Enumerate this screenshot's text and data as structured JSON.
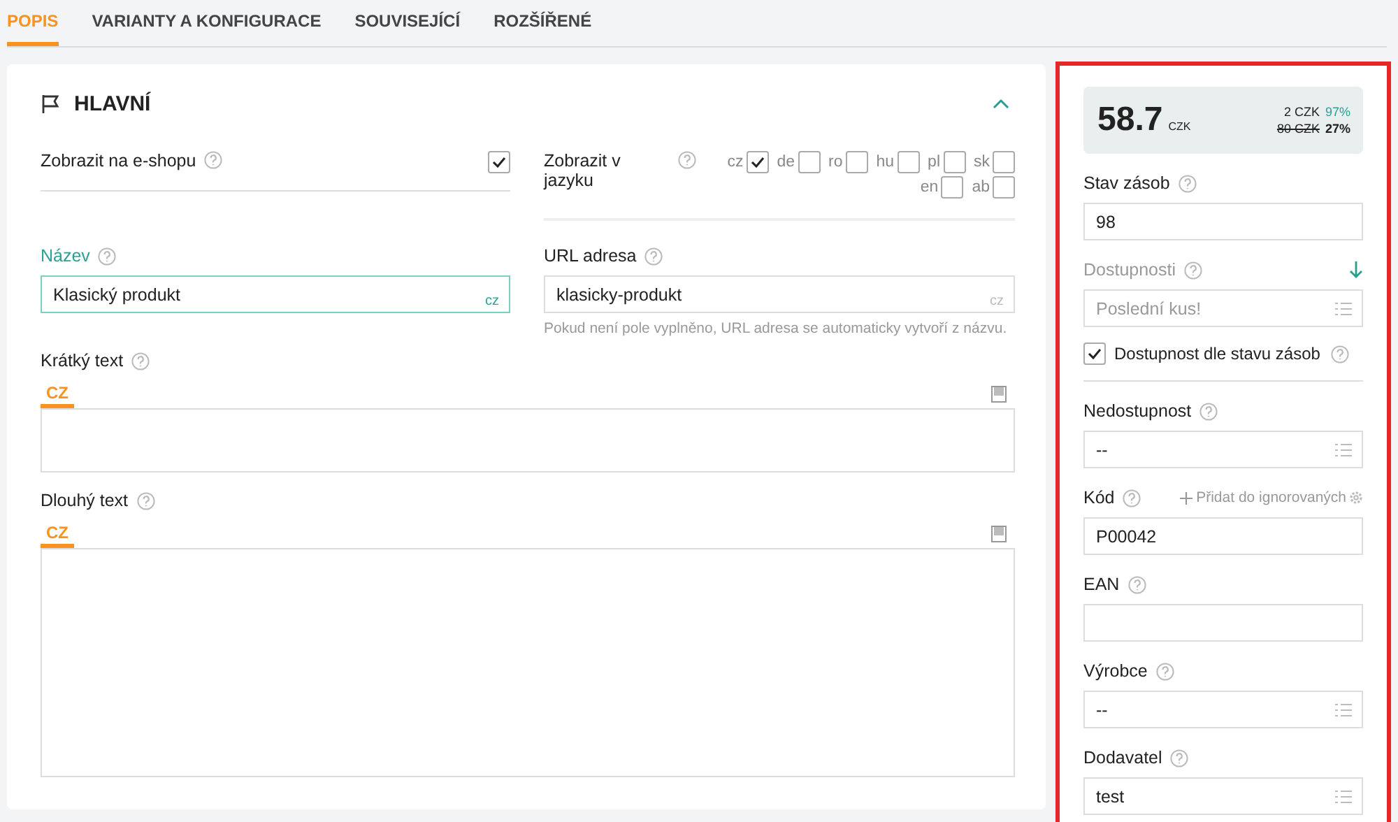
{
  "tabs": [
    {
      "label": "POPIS",
      "selected": true
    },
    {
      "label": "VARIANTY A KONFIGURACE",
      "selected": false
    },
    {
      "label": "SOUVISEJÍCÍ",
      "selected": false
    },
    {
      "label": "ROZŠÍŘENÉ",
      "selected": false
    }
  ],
  "section": {
    "title": "HLAVNÍ",
    "expanded": true
  },
  "show_on_eshop": {
    "label": "Zobrazit na e-shopu",
    "checked": true
  },
  "languages": {
    "label": "Zobrazit v jazyku",
    "items": [
      {
        "code": "cz",
        "checked": true
      },
      {
        "code": "de",
        "checked": false
      },
      {
        "code": "ro",
        "checked": false
      },
      {
        "code": "hu",
        "checked": false
      },
      {
        "code": "pl",
        "checked": false
      },
      {
        "code": "sk",
        "checked": false
      },
      {
        "code": "en",
        "checked": false
      },
      {
        "code": "ab",
        "checked": false
      }
    ]
  },
  "name_field": {
    "label": "Název",
    "value": "Klasický produkt",
    "lang": "cz",
    "focused": true
  },
  "url_field": {
    "label": "URL adresa",
    "value": "klasicky-produkt",
    "lang": "cz",
    "hint": "Pokud není pole vyplněno, URL adresa se automaticky vytvoří z názvu.",
    "focused": false
  },
  "editors": [
    {
      "label": "Krátký text",
      "tab": "CZ",
      "kind": "short"
    },
    {
      "label": "Dlouhý text",
      "tab": "CZ",
      "kind": "long"
    }
  ],
  "price": {
    "value": "58.7",
    "currency": "CZK",
    "rows": [
      {
        "price": "2 CZK",
        "percent": "97%",
        "struck": false,
        "highlighted": true
      },
      {
        "price": "80 CZK",
        "percent": "27%",
        "struck": true,
        "highlighted": false
      }
    ]
  },
  "side_fields": [
    {
      "kind": "text",
      "label": "Stav zásob",
      "value": "98"
    },
    {
      "kind": "select",
      "label": "Dostupnosti",
      "placeholder": "Poslední kus!",
      "disabled": true,
      "sort_arrow": true
    },
    {
      "kind": "checkbox",
      "label": "Dostupnost dle stavu zásob",
      "checked": true
    },
    {
      "kind": "select",
      "label": "Nedostupnost",
      "value": "--"
    },
    {
      "kind": "text",
      "label": "Kód",
      "value": "P00042",
      "action": "Přidat do ignorovaných"
    },
    {
      "kind": "text",
      "label": "EAN"
    },
    {
      "kind": "select",
      "label": "Výrobce",
      "value": "--"
    },
    {
      "kind": "select",
      "label": "Dodavatel",
      "value": "test"
    }
  ]
}
